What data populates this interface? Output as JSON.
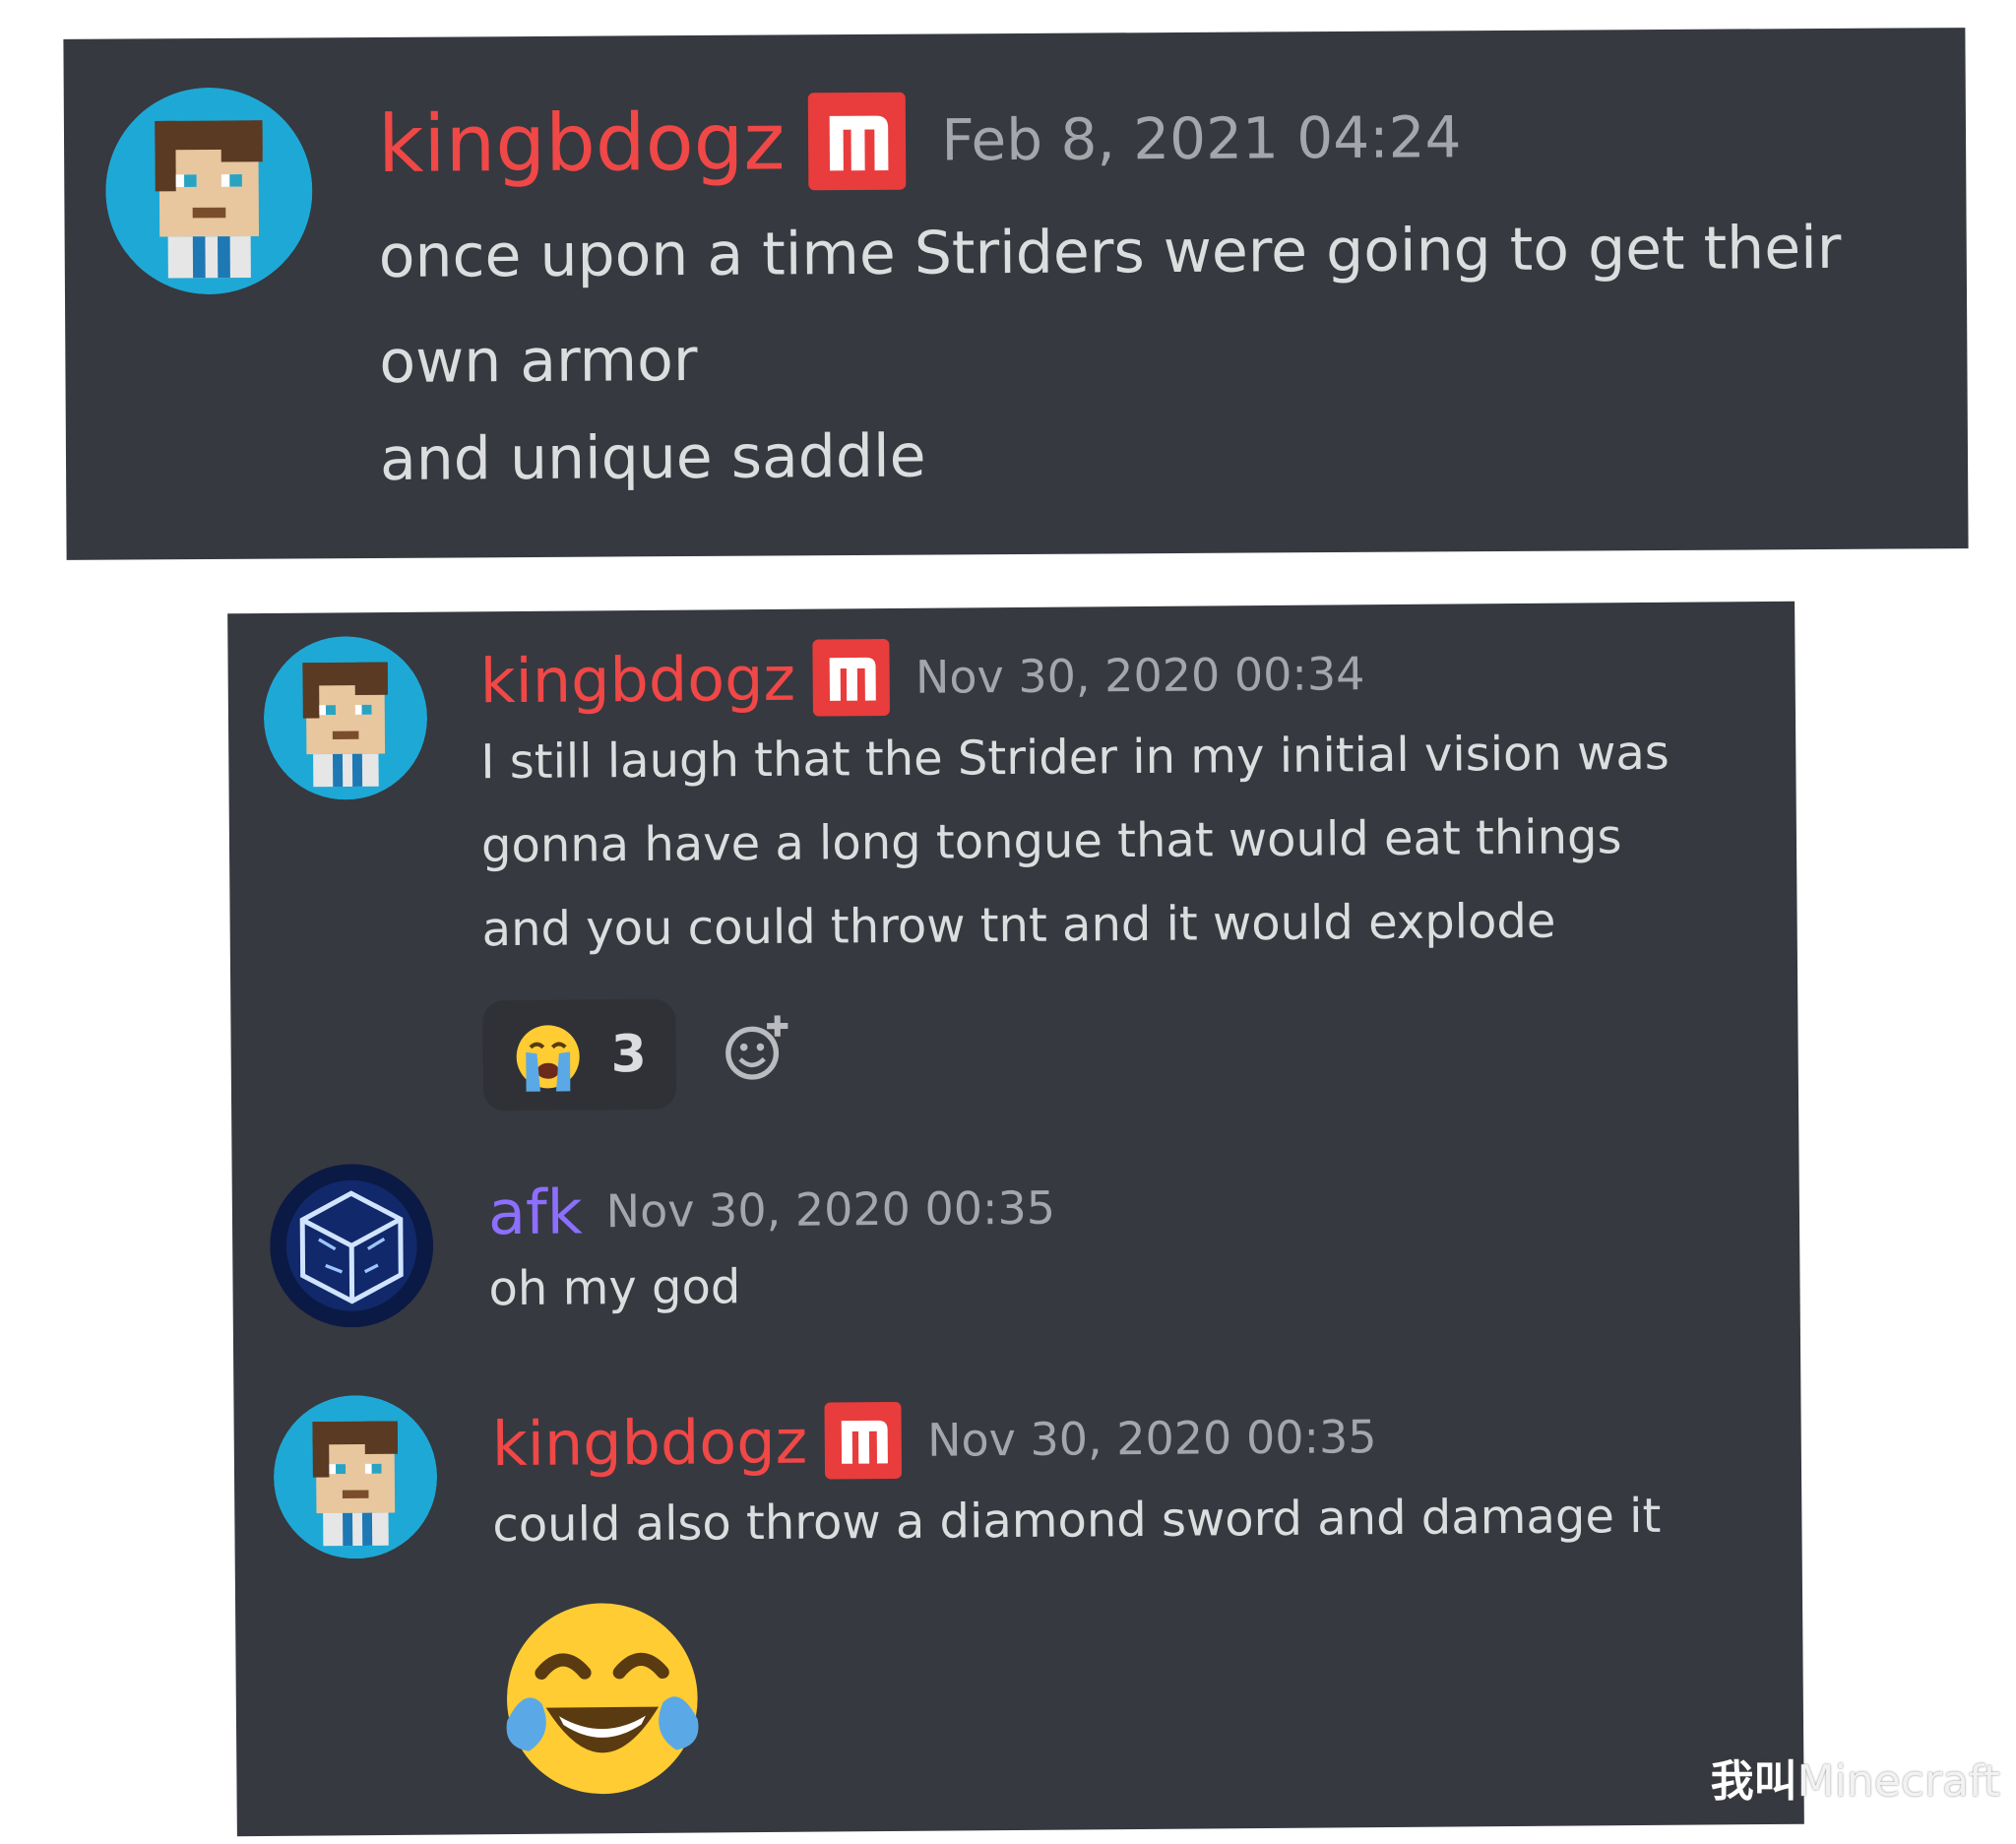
{
  "panel_top": {
    "message": {
      "username": "kingbdogz",
      "badge_icon": "mojang-m-badge-icon",
      "timestamp": "Feb 8, 2021 04:24",
      "lines": [
        "once upon a time Striders were going to get their",
        "own armor",
        "and unique saddle"
      ]
    }
  },
  "panel_bottom": {
    "messages": [
      {
        "username": "kingbdogz",
        "badge_icon": "mojang-m-badge-icon",
        "timestamp": "Nov 30, 2020 00:34",
        "lines": [
          "I still laugh that the Strider in my initial vision was",
          "gonna have a long tongue that would eat things",
          "and you could throw tnt and it would explode"
        ],
        "reaction": {
          "emoji_icon": "crying-face-icon",
          "count": "3"
        },
        "add_reaction_icon": "add-reaction-icon"
      },
      {
        "username": "afk",
        "timestamp": "Nov 30, 2020 00:35",
        "lines": [
          "oh my god"
        ]
      },
      {
        "username": "kingbdogz",
        "badge_icon": "mojang-m-badge-icon",
        "timestamp": "Nov 30, 2020 00:35",
        "lines": [
          "could also throw a diamond sword and damage it"
        ],
        "big_emoji_icon": "tears-of-joy-icon"
      }
    ]
  },
  "colors": {
    "background": "#36393f",
    "username_red": "#f04747",
    "username_purple": "#8c6fff",
    "timestamp": "#a3a6aa",
    "text": "#dcddde"
  },
  "watermark": {
    "cjk": "我叫",
    "latin": "Minecraft"
  }
}
